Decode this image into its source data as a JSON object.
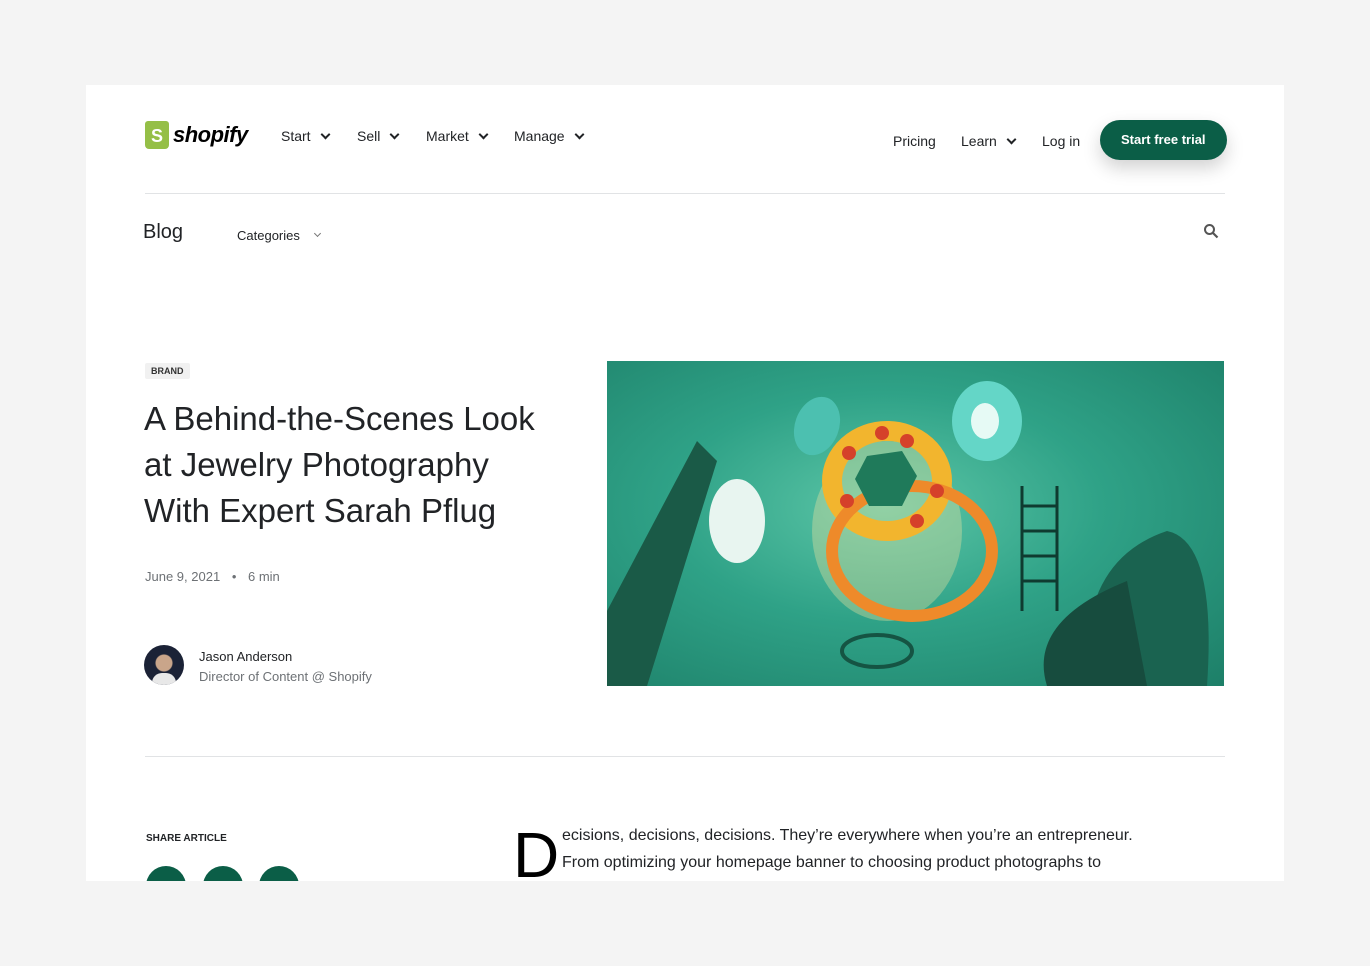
{
  "header": {
    "logo": "shopify",
    "nav": [
      "Start",
      "Sell",
      "Market",
      "Manage"
    ],
    "right": {
      "pricing": "Pricing",
      "learn": "Learn",
      "login": "Log in",
      "cta": "Start free trial"
    }
  },
  "subnav": {
    "blog": "Blog",
    "categories": "Categories"
  },
  "article": {
    "badge": "BRAND",
    "title": "A Behind-the-Scenes Look at Jewelry Photography With Expert Sarah Pflug",
    "date": "June 9, 2021",
    "read_time": "6 min",
    "author": {
      "name": "Jason Anderson",
      "role": "Director of Content @ Shopify"
    },
    "share_label": "SHARE ARTICLE",
    "dropcap": "D",
    "body_lines": [
      "ecisions, decisions, decisions. They’re everywhere when you’re an entrepreneur.",
      "From optimizing your homepage banner to choosing product photographs to"
    ]
  },
  "colors": {
    "brand_green": "#0b5e47",
    "logo_green": "#95bf47",
    "page_bg": "#f4f4f4"
  }
}
